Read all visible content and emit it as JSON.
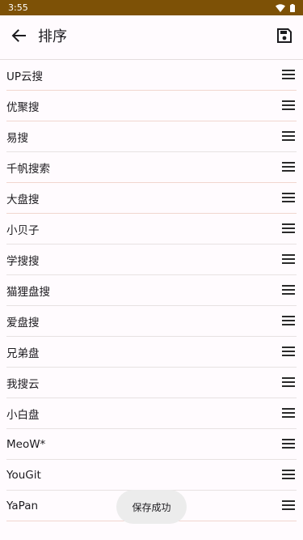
{
  "status_bar": {
    "time": "3:55",
    "icons": [
      "wifi-icon",
      "battery-icon"
    ],
    "background": "#7d5106"
  },
  "app_bar": {
    "back_icon": "arrow-left-icon",
    "title": "排序",
    "save_icon": "save-disk-icon"
  },
  "list": {
    "items": [
      {
        "label": "UP云搜"
      },
      {
        "label": "优聚搜"
      },
      {
        "label": "易搜"
      },
      {
        "label": "千帆搜索"
      },
      {
        "label": "大盘搜"
      },
      {
        "label": "小贝子"
      },
      {
        "label": "学搜搜"
      },
      {
        "label": "猫狸盘搜"
      },
      {
        "label": "爱盘搜"
      },
      {
        "label": "兄弟盘"
      },
      {
        "label": "我搜云"
      },
      {
        "label": "小白盘"
      },
      {
        "label": "MeoW*"
      },
      {
        "label": "YouGit"
      },
      {
        "label": "YaPan"
      }
    ],
    "handle_icon": "drag-handle-icon"
  },
  "toast": {
    "text": "保存成功"
  }
}
